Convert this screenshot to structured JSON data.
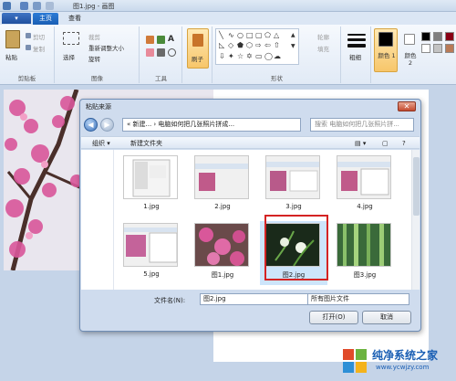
{
  "window": {
    "title": "图1.jpg - 画图"
  },
  "tabs": {
    "home": "主页",
    "view": "查看"
  },
  "ribbon": {
    "clipboard": {
      "paste": "粘贴",
      "cut": "剪切",
      "copy": "复制",
      "label": "剪贴板"
    },
    "image": {
      "select": "选择",
      "crop": "裁剪",
      "resize": "重新调整大小",
      "rotate": "旋转",
      "label": "图像"
    },
    "tools": {
      "label": "工具"
    },
    "brushes": "刷子",
    "shapes": {
      "outline": "轮廓",
      "fill": "填充",
      "label": "形状"
    },
    "size": "粗细",
    "color1": "颜色 1",
    "color2": "颜色 2"
  },
  "dialog": {
    "title": "粘贴来源",
    "address": "« 新建... › 电脑如何把几张照片拼成...",
    "search_placeholder": "搜索 电脑如何把几张照片拼...",
    "organize": "组织 ▾",
    "new_folder": "新建文件夹",
    "files": [
      {
        "name": "1.jpg"
      },
      {
        "name": "2.jpg"
      },
      {
        "name": "3.jpg"
      },
      {
        "name": "4.jpg"
      },
      {
        "name": "5.jpg"
      },
      {
        "name": "图1.jpg"
      },
      {
        "name": "图2.jpg"
      },
      {
        "name": "图3.jpg"
      }
    ],
    "filename_label": "文件名(N):",
    "filename_value": "图2.jpg",
    "filetype": "所有图片文件",
    "open": "打开(O)",
    "cancel": "取消"
  },
  "watermark": {
    "title": "纯净系统之家",
    "url": "www.ycwjzy.com"
  },
  "colors": {
    "accent": "#1a5fb4",
    "selection": "#d42323",
    "dialog_bg": "#cfdcee"
  }
}
